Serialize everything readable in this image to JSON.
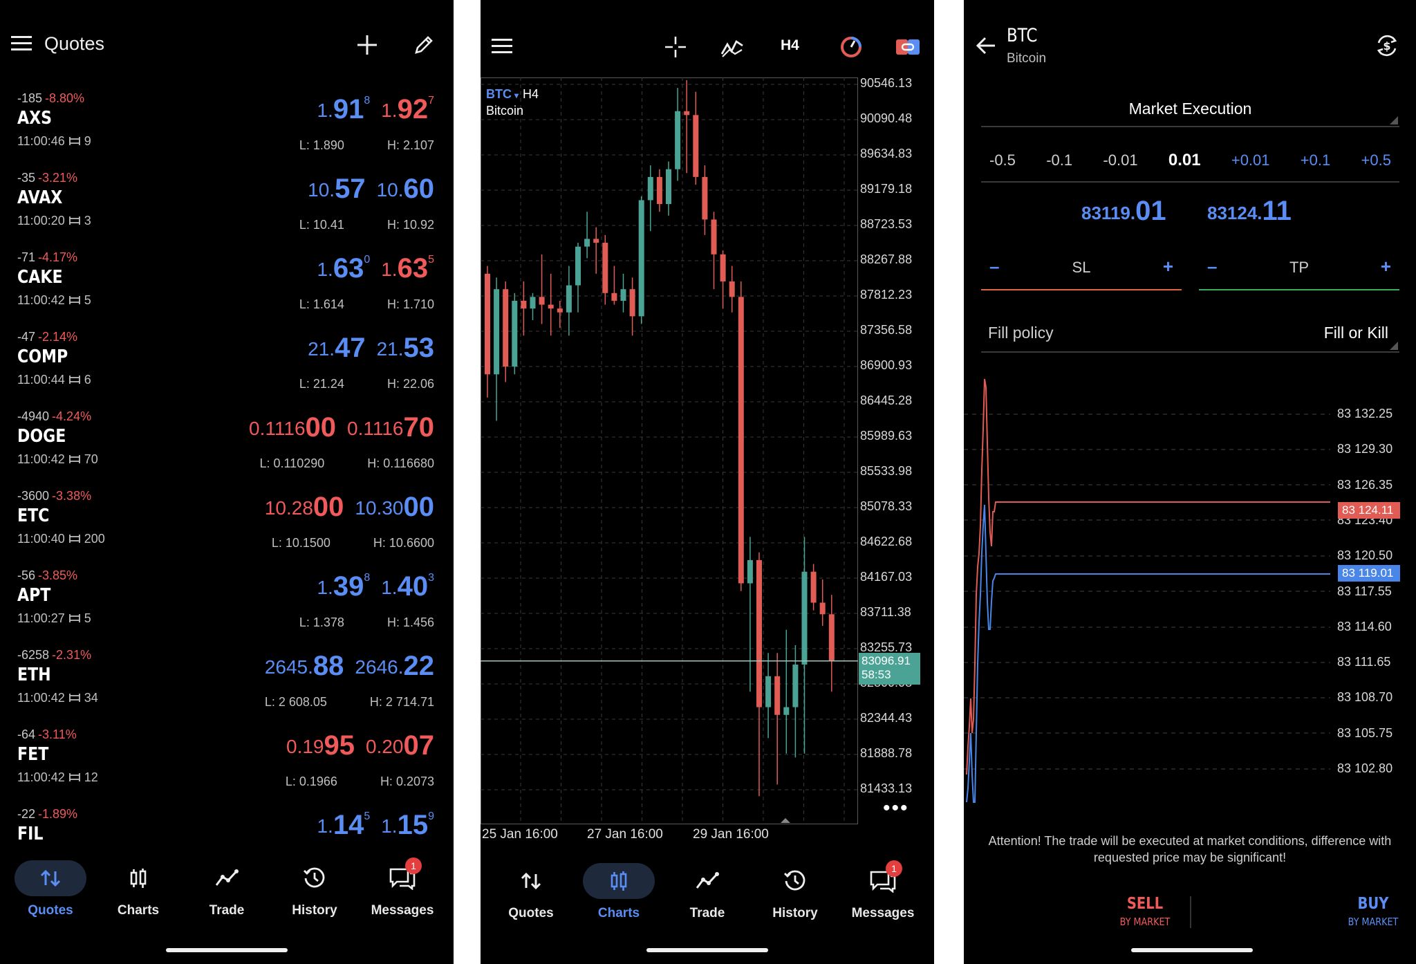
{
  "colors": {
    "blue": "#5b8ef5",
    "red": "#f05a5a",
    "bull": "#4aa394",
    "bear": "#e05c55",
    "background": "#000000"
  },
  "quotes_screen": {
    "title": "Quotes",
    "icons": [
      "hamburger-menu-icon",
      "plus-icon",
      "edit-pencil-icon"
    ],
    "rows": [
      {
        "change_points": "-185",
        "change_pct": "-8.80%",
        "symbol": "AXS",
        "time": "11:00:46",
        "spread": "9",
        "bid": {
          "a": "1.",
          "b": "91",
          "c": "8",
          "color": "blue"
        },
        "ask": {
          "a": "1.",
          "b": "92",
          "c": "7",
          "color": "red"
        },
        "low": "L: 1.890",
        "high": "H: 2.107"
      },
      {
        "change_points": "-35",
        "change_pct": "-3.21%",
        "symbol": "AVAX",
        "time": "11:00:20",
        "spread": "3",
        "bid": {
          "a": "10.",
          "b": "57",
          "c": "",
          "color": "blue"
        },
        "ask": {
          "a": "10.",
          "b": "60",
          "c": "",
          "color": "blue"
        },
        "low": "L: 10.41",
        "high": "H: 10.92"
      },
      {
        "change_points": "-71",
        "change_pct": "-4.17%",
        "symbol": "CAKE",
        "time": "11:00:42",
        "spread": "5",
        "bid": {
          "a": "1.",
          "b": "63",
          "c": "0",
          "color": "blue"
        },
        "ask": {
          "a": "1.",
          "b": "63",
          "c": "5",
          "color": "red"
        },
        "low": "L: 1.614",
        "high": "H: 1.710"
      },
      {
        "change_points": "-47",
        "change_pct": "-2.14%",
        "symbol": "COMP",
        "time": "11:00:44",
        "spread": "6",
        "bid": {
          "a": "21.",
          "b": "47",
          "c": "",
          "color": "blue"
        },
        "ask": {
          "a": "21.",
          "b": "53",
          "c": "",
          "color": "blue"
        },
        "low": "L: 21.24",
        "high": "H: 22.06"
      },
      {
        "change_points": "-4940",
        "change_pct": "-4.24%",
        "symbol": "DOGE",
        "time": "11:00:42",
        "spread": "70",
        "bid": {
          "a": "0.1116",
          "b": "00",
          "c": "",
          "color": "red"
        },
        "ask": {
          "a": "0.1116",
          "b": "70",
          "c": "",
          "color": "red"
        },
        "low": "L: 0.110290",
        "high": "H: 0.116680"
      },
      {
        "change_points": "-3600",
        "change_pct": "-3.38%",
        "symbol": "ETC",
        "time": "11:00:40",
        "spread": "200",
        "bid": {
          "a": "10.28",
          "b": "00",
          "c": "",
          "color": "red"
        },
        "ask": {
          "a": "10.30",
          "b": "00",
          "c": "",
          "color": "blue"
        },
        "low": "L: 10.1500",
        "high": "H: 10.6600"
      },
      {
        "change_points": "-56",
        "change_pct": "-3.85%",
        "symbol": "APT",
        "time": "11:00:27",
        "spread": "5",
        "bid": {
          "a": "1.",
          "b": "39",
          "c": "8",
          "color": "blue"
        },
        "ask": {
          "a": "1.",
          "b": "40",
          "c": "3",
          "color": "blue"
        },
        "low": "L: 1.378",
        "high": "H: 1.456"
      },
      {
        "change_points": "-6258",
        "change_pct": "-2.31%",
        "symbol": "ETH",
        "time": "11:00:42",
        "spread": "34",
        "bid": {
          "a": "2645.",
          "b": "88",
          "c": "",
          "color": "blue"
        },
        "ask": {
          "a": "2646.",
          "b": "22",
          "c": "",
          "color": "blue"
        },
        "low": "L: 2 608.05",
        "high": "H: 2 714.71"
      },
      {
        "change_points": "-64",
        "change_pct": "-3.11%",
        "symbol": "FET",
        "time": "11:00:42",
        "spread": "12",
        "bid": {
          "a": "0.19",
          "b": "95",
          "c": "",
          "color": "red"
        },
        "ask": {
          "a": "0.20",
          "b": "07",
          "c": "",
          "color": "red"
        },
        "low": "L: 0.1966",
        "high": "H: 0.2073"
      },
      {
        "change_points": "-22",
        "change_pct": "-1.89%",
        "symbol": "FIL",
        "time": "",
        "spread": "",
        "bid": {
          "a": "1.",
          "b": "14",
          "c": "5",
          "color": "blue"
        },
        "ask": {
          "a": "1.",
          "b": "15",
          "c": "9",
          "color": "blue"
        },
        "low": "",
        "high": ""
      }
    ]
  },
  "nav": {
    "items": [
      {
        "label": "Quotes",
        "icon": "quotes-arrows-icon"
      },
      {
        "label": "Charts",
        "icon": "candlestick-icon"
      },
      {
        "label": "Trade",
        "icon": "trade-line-icon"
      },
      {
        "label": "History",
        "icon": "history-clock-icon"
      },
      {
        "label": "Messages",
        "icon": "messages-icon"
      }
    ],
    "messages_badge": "1"
  },
  "chart_screen": {
    "toolbar_timeframe": "H4",
    "toolbar_icons": [
      "hamburger-menu-icon",
      "crosshair-icon",
      "indicators-icon",
      "timeframe",
      "objects-icon",
      "trade-toggle-icon"
    ],
    "symbol": "BTC",
    "symbol_caret": "▾",
    "timeframe": "H4",
    "description": "Bitcoin",
    "current_price": "83096.91",
    "countdown": "58:53",
    "more": "•••",
    "chart_data": {
      "type": "candlestick",
      "y_ticks": [
        "90546.13",
        "90090.48",
        "89634.83",
        "89179.18",
        "88723.53",
        "88267.88",
        "87812.23",
        "87356.58",
        "86900.93",
        "86445.28",
        "85989.63",
        "85533.98",
        "85078.33",
        "84622.68",
        "84167.03",
        "83711.38",
        "83255.73",
        "82800.08",
        "82344.43",
        "81888.78",
        "81433.13"
      ],
      "ylim": [
        81200,
        90700
      ],
      "x_labels": [
        "25 Jan 16:00",
        "27 Jan 16:00",
        "29 Jan 16:00"
      ],
      "current_price": 83096.91,
      "candles": [
        [
          88100,
          88200,
          86500,
          86800
        ],
        [
          86800,
          88050,
          86200,
          87900
        ],
        [
          87900,
          88000,
          86700,
          86900
        ],
        [
          86900,
          87850,
          86800,
          87750
        ],
        [
          87750,
          88000,
          87300,
          87650
        ],
        [
          87650,
          87850,
          87500,
          87800
        ],
        [
          87800,
          88350,
          87450,
          87700
        ],
        [
          87700,
          88100,
          87300,
          87650
        ],
        [
          87650,
          87750,
          87400,
          87600
        ],
        [
          87600,
          88200,
          87300,
          87950
        ],
        [
          87950,
          88500,
          87600,
          88450
        ],
        [
          88450,
          88900,
          88300,
          88550
        ],
        [
          88550,
          88700,
          88100,
          88500
        ],
        [
          88500,
          88600,
          87700,
          87850
        ],
        [
          87850,
          88200,
          87700,
          87750
        ],
        [
          87750,
          88100,
          87600,
          87900
        ],
        [
          87900,
          88050,
          87300,
          87550
        ],
        [
          87550,
          89100,
          87450,
          89050
        ],
        [
          89050,
          89500,
          88650,
          89350
        ],
        [
          89350,
          89450,
          88900,
          89000
        ],
        [
          89000,
          89550,
          88850,
          89450
        ],
        [
          89450,
          90500,
          89300,
          90200
        ],
        [
          90200,
          90600,
          89400,
          90150
        ],
        [
          90150,
          90450,
          89250,
          89350
        ],
        [
          89350,
          89500,
          88600,
          88800
        ],
        [
          88800,
          88900,
          87900,
          88350
        ],
        [
          88350,
          88400,
          87650,
          88000
        ],
        [
          88000,
          88200,
          87600,
          87800
        ],
        [
          87800,
          88000,
          84000,
          84100
        ],
        [
          84100,
          84700,
          82700,
          84400
        ],
        [
          84400,
          84500,
          81350,
          82500
        ],
        [
          82500,
          83200,
          82100,
          82900
        ],
        [
          82900,
          83200,
          81500,
          82400
        ],
        [
          82400,
          83500,
          81900,
          82500
        ],
        [
          82500,
          83300,
          81850,
          83050
        ],
        [
          83050,
          84700,
          81900,
          84250
        ],
        [
          84250,
          84350,
          83750,
          83850
        ],
        [
          83850,
          84150,
          83550,
          83700
        ],
        [
          83700,
          83950,
          82700,
          83100
        ]
      ]
    }
  },
  "order_screen": {
    "symbol": "BTC",
    "description": "Bitcoin",
    "execution": "Market Execution",
    "volumes": [
      "-0.5",
      "-0.1",
      "-0.01",
      "0.01",
      "+0.01",
      "+0.1",
      "+0.5"
    ],
    "bid": {
      "a": "83119.",
      "b": "01"
    },
    "ask": {
      "a": "83124.",
      "b": "11"
    },
    "sl_label": "SL",
    "tp_label": "TP",
    "minus": "–",
    "plus": "+",
    "fill_policy_label": "Fill policy",
    "fill_policy_value": "Fill or Kill",
    "tick_chart": {
      "type": "line",
      "y_ticks": [
        "83 132.25",
        "83 129.30",
        "83 126.35",
        "83 123.40",
        "83 120.50",
        "83 117.55",
        "83 114.60",
        "83 111.65",
        "83 108.70",
        "83 105.75",
        "83 102.80"
      ],
      "ask_marker": "83 124.11",
      "bid_marker": "83 119.01"
    },
    "attention": "Attention! The trade will be executed at market conditions, difference with requested price may be significant!",
    "sell": {
      "label": "SELL",
      "sub": "BY MARKET"
    },
    "buy": {
      "label": "BUY",
      "sub": "BY MARKET"
    }
  }
}
